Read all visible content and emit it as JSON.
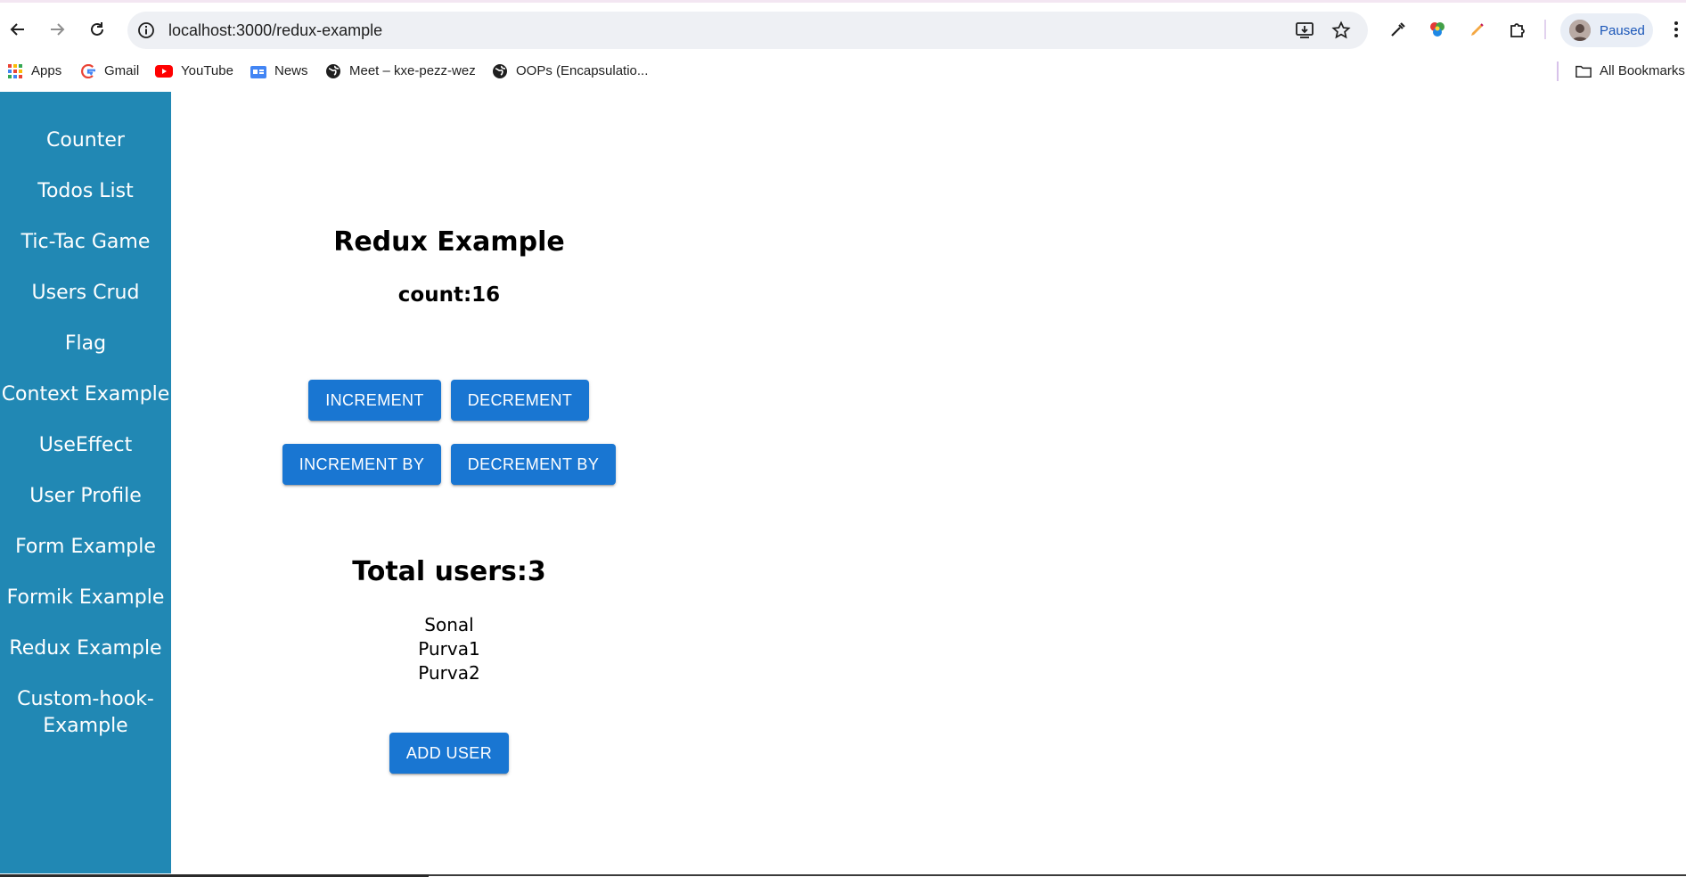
{
  "browser": {
    "url_host": "localhost:3000/redux-example",
    "profile_label": "Paused",
    "bookmarks": [
      {
        "label": "Apps",
        "icon": "apps-grid-icon"
      },
      {
        "label": "Gmail",
        "icon": "google-icon"
      },
      {
        "label": "YouTube",
        "icon": "youtube-icon"
      },
      {
        "label": "News",
        "icon": "news-icon"
      },
      {
        "label": "Meet – kxe-pezz-wez",
        "icon": "globe-icon"
      },
      {
        "label": "OOPs (Encapsulatio...",
        "icon": "globe-icon"
      }
    ],
    "all_bookmarks_label": "All Bookmarks"
  },
  "sidebar": {
    "items": [
      {
        "label": "Counter"
      },
      {
        "label": "Todos List"
      },
      {
        "label": "Tic-Tac Game"
      },
      {
        "label": "Users Crud"
      },
      {
        "label": "Flag"
      },
      {
        "label": "Context Example"
      },
      {
        "label": "UseEffect"
      },
      {
        "label": "User Profile"
      },
      {
        "label": "Form Example"
      },
      {
        "label": "Formik Example"
      },
      {
        "label": "Redux Example"
      },
      {
        "label": "Custom-hook-",
        "label2": "Example"
      }
    ]
  },
  "main": {
    "title": "Redux Example",
    "count_text": "count:16",
    "buttons": {
      "increment": "INCREMENT",
      "decrement": "DECREMENT",
      "increment_by": "INCREMENT BY",
      "decrement_by": "DECREMENT BY",
      "add_user": "ADD USER"
    },
    "users_title": "Total users:3",
    "users": [
      "Sonal",
      "Purva1",
      "Purva2"
    ]
  },
  "colors": {
    "sidebar_bg": "#2188b4",
    "button_bg": "#1976d2",
    "accent_link": "#1a56b8"
  }
}
